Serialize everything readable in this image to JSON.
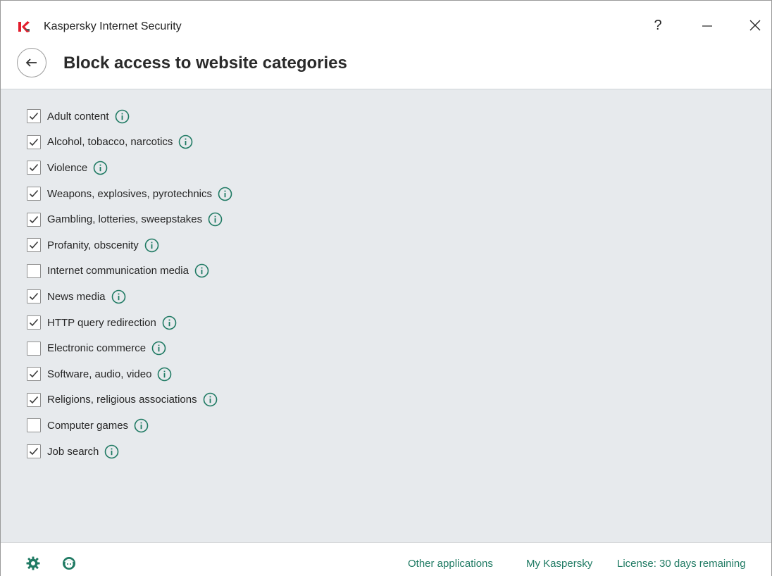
{
  "window": {
    "title": "Kaspersky Internet Security",
    "help_label": "?",
    "logo_icon": "kaspersky-logo",
    "accent_color": "#1f7a63",
    "logo_color": "#e21d2c"
  },
  "header": {
    "title": "Block access to website categories",
    "back_icon": "arrow-left-icon"
  },
  "categories": [
    {
      "label": "Adult content",
      "checked": true
    },
    {
      "label": "Alcohol, tobacco, narcotics",
      "checked": true
    },
    {
      "label": "Violence",
      "checked": true
    },
    {
      "label": "Weapons, explosives, pyrotechnics",
      "checked": true
    },
    {
      "label": "Gambling, lotteries, sweepstakes",
      "checked": true
    },
    {
      "label": "Profanity, obscenity",
      "checked": true
    },
    {
      "label": "Internet communication media",
      "checked": false
    },
    {
      "label": "News media",
      "checked": true
    },
    {
      "label": "HTTP query redirection",
      "checked": true
    },
    {
      "label": "Electronic commerce",
      "checked": false
    },
    {
      "label": "Software, audio, video",
      "checked": true
    },
    {
      "label": "Religions, religious associations",
      "checked": true
    },
    {
      "label": "Computer games",
      "checked": false
    },
    {
      "label": "Job search",
      "checked": true
    }
  ],
  "footer": {
    "settings_icon": "gear-icon",
    "support_icon": "support-agent-icon",
    "links": {
      "other_applications": "Other applications",
      "my_kaspersky": "My Kaspersky",
      "license": "License: 30 days remaining"
    }
  }
}
